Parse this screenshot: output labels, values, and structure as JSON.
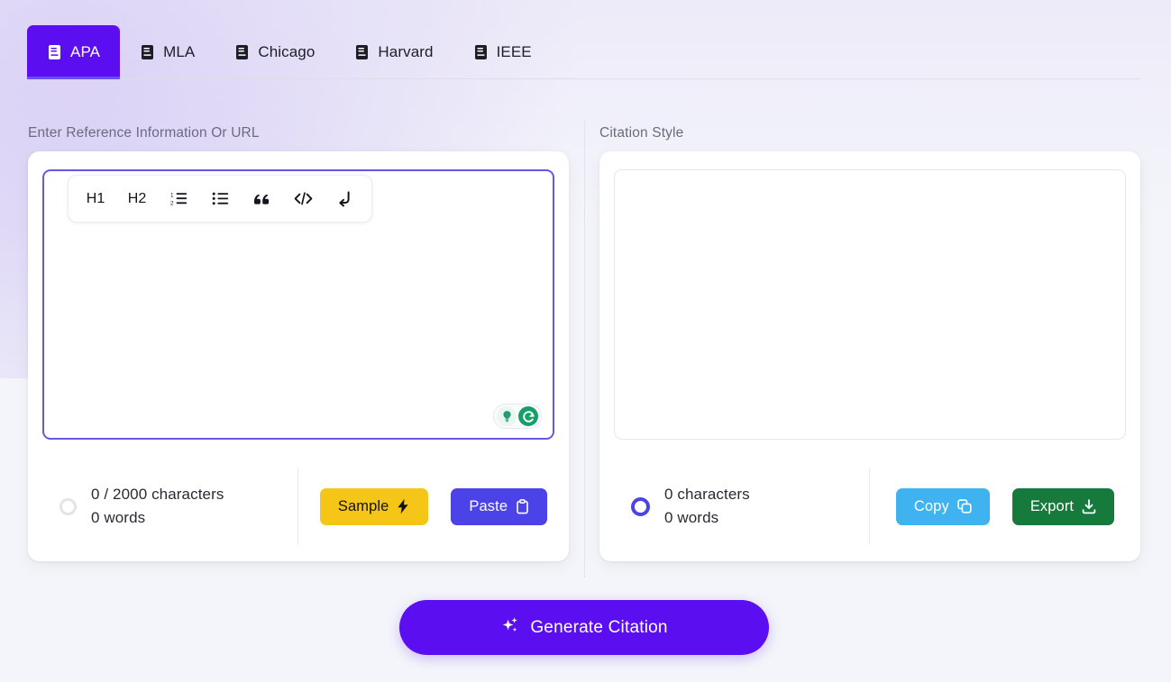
{
  "tabs": [
    {
      "label": "APA",
      "icon": "book-icon",
      "active": true
    },
    {
      "label": "MLA",
      "icon": "book-icon",
      "active": false
    },
    {
      "label": "Chicago",
      "icon": "book-icon",
      "active": false
    },
    {
      "label": "Harvard",
      "icon": "book-icon",
      "active": false
    },
    {
      "label": "IEEE",
      "icon": "book-icon",
      "active": false
    }
  ],
  "left_panel": {
    "section_label": "Enter Reference Information Or URL",
    "editor": {
      "value": "",
      "placeholder": "",
      "toolbar": [
        {
          "name": "heading-1-button",
          "label": "H1"
        },
        {
          "name": "heading-2-button",
          "label": "H2"
        },
        {
          "name": "ordered-list-button",
          "label": ""
        },
        {
          "name": "bullet-list-button",
          "label": ""
        },
        {
          "name": "blockquote-button",
          "label": ""
        },
        {
          "name": "code-block-button",
          "label": ""
        },
        {
          "name": "line-break-button",
          "label": ""
        }
      ],
      "assistant_badge": {
        "bulb_icon": "lightbulb-icon",
        "logo_icon": "grammarly-logo-icon"
      }
    },
    "counter": {
      "characters": "0 / 2000 characters",
      "words": "0 words",
      "progress_percent": 0
    },
    "buttons": {
      "sample": {
        "label": "Sample",
        "icon": "lightning-bolt-icon",
        "color": "#f5c518"
      },
      "paste": {
        "label": "Paste",
        "icon": "clipboard-icon",
        "color": "#4b42e8"
      }
    }
  },
  "right_panel": {
    "section_label": "Citation Style",
    "output": {
      "value": ""
    },
    "counter": {
      "characters": "0 characters",
      "words": "0 words"
    },
    "buttons": {
      "copy": {
        "label": "Copy",
        "icon": "copy-icon",
        "color": "#3fb3f0"
      },
      "export": {
        "label": "Export",
        "icon": "download-icon",
        "color": "#167a3c"
      }
    }
  },
  "generate_button": {
    "label": "Generate Citation",
    "icon": "sparkles-icon",
    "color": "#5b0ef0"
  }
}
